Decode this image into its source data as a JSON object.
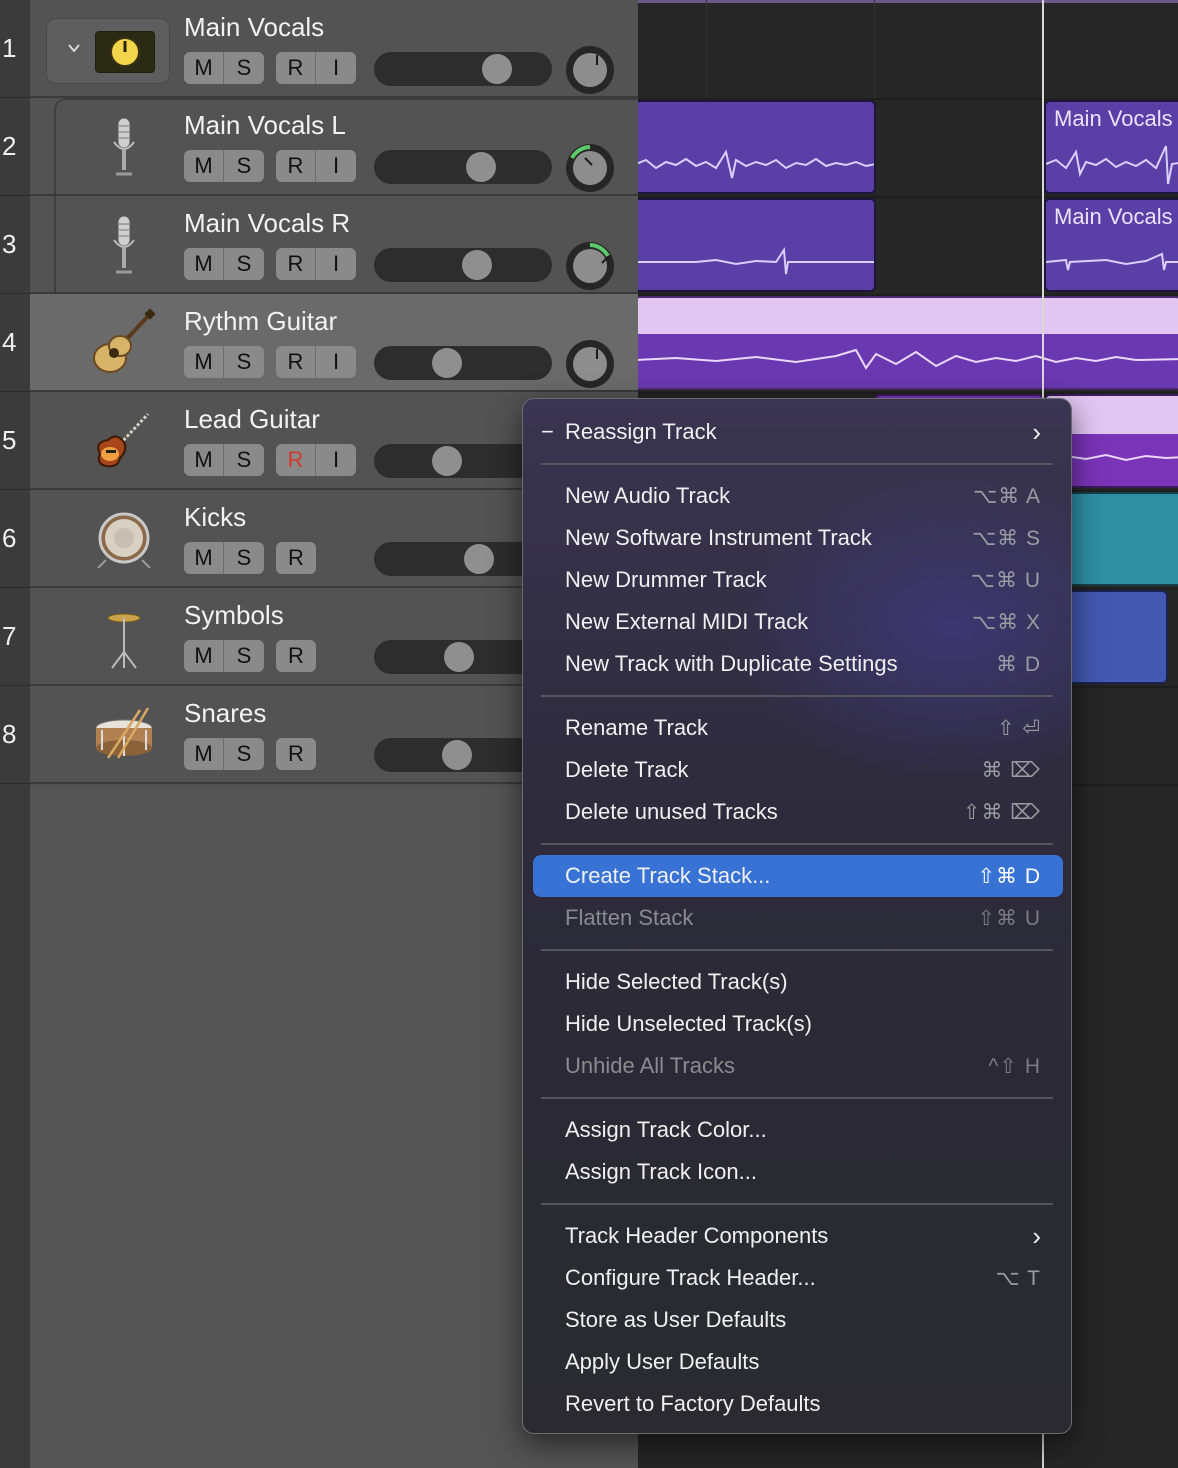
{
  "tracks": [
    {
      "number": "1",
      "name": "Main Vocals",
      "buttons": [
        "M",
        "S",
        "R",
        "I"
      ],
      "icon": "track-stack-icon"
    },
    {
      "number": "2",
      "name": "Main Vocals L",
      "buttons": [
        "M",
        "S",
        "R",
        "I"
      ],
      "icon": "condenser-mic-icon"
    },
    {
      "number": "3",
      "name": "Main Vocals R",
      "buttons": [
        "M",
        "S",
        "R",
        "I"
      ],
      "icon": "condenser-mic-icon"
    },
    {
      "number": "4",
      "name": "Rythm Guitar",
      "buttons": [
        "M",
        "S",
        "R",
        "I"
      ],
      "icon": "acoustic-guitar-icon"
    },
    {
      "number": "5",
      "name": "Lead Guitar",
      "buttons": [
        "M",
        "S",
        "R",
        "I"
      ],
      "icon": "electric-guitar-icon"
    },
    {
      "number": "6",
      "name": "Kicks",
      "buttons": [
        "M",
        "S",
        "R"
      ],
      "icon": "kick-drum-icon"
    },
    {
      "number": "7",
      "name": "Symbols",
      "buttons": [
        "M",
        "S",
        "R"
      ],
      "icon": "cymbal-icon"
    },
    {
      "number": "8",
      "name": "Snares",
      "buttons": [
        "M",
        "S",
        "R"
      ],
      "icon": "snare-drum-icon"
    }
  ],
  "regions": {
    "main_vocals_label": "Main Vocals"
  },
  "context_menu": {
    "reassign": {
      "label": "Reassign Track",
      "prefix": "−"
    },
    "new_audio": {
      "label": "New Audio Track",
      "shortcut": "⌥⌘ A"
    },
    "new_software": {
      "label": "New Software Instrument Track",
      "shortcut": "⌥⌘ S"
    },
    "new_drummer": {
      "label": "New Drummer Track",
      "shortcut": "⌥⌘ U"
    },
    "new_midi": {
      "label": "New External MIDI Track",
      "shortcut": "⌥⌘ X"
    },
    "new_duplicate": {
      "label": "New Track with Duplicate Settings",
      "shortcut": "⌘ D"
    },
    "rename": {
      "label": "Rename Track",
      "shortcut": "⇧ ⏎"
    },
    "delete": {
      "label": "Delete Track",
      "shortcut": "⌘ ⌦"
    },
    "delete_unused": {
      "label": "Delete unused Tracks",
      "shortcut": "⇧⌘ ⌦"
    },
    "create_stack": {
      "label": "Create Track Stack...",
      "shortcut": "⇧⌘ D"
    },
    "flatten": {
      "label": "Flatten Stack",
      "shortcut": "⇧⌘ U"
    },
    "hide_selected": {
      "label": "Hide Selected Track(s)"
    },
    "hide_unselected": {
      "label": "Hide Unselected Track(s)"
    },
    "unhide_all": {
      "label": "Unhide All Tracks",
      "shortcut": "^⇧ H"
    },
    "assign_color": {
      "label": "Assign Track Color..."
    },
    "assign_icon": {
      "label": "Assign Track Icon..."
    },
    "header_components": {
      "label": "Track Header Components"
    },
    "configure_header": {
      "label": "Configure Track Header...",
      "shortcut": "⌥ T"
    },
    "store_defaults": {
      "label": "Store as User Defaults"
    },
    "apply_defaults": {
      "label": "Apply User Defaults"
    },
    "revert_defaults": {
      "label": "Revert to Factory Defaults"
    },
    "submenu_chevron": "›"
  },
  "colors": {
    "vocal_region": "#5a3fa6",
    "guitar_region": "#e2c6f2",
    "lead_region": "#7a34b8",
    "kick_region": "#2f8fa3",
    "symbol_region": "#4458b0",
    "menu_highlight": "#3772d4",
    "record_armed": "#d23a2e",
    "stack_icon_yellow": "#f2d54a",
    "pan_active_green": "#5ec96a"
  }
}
